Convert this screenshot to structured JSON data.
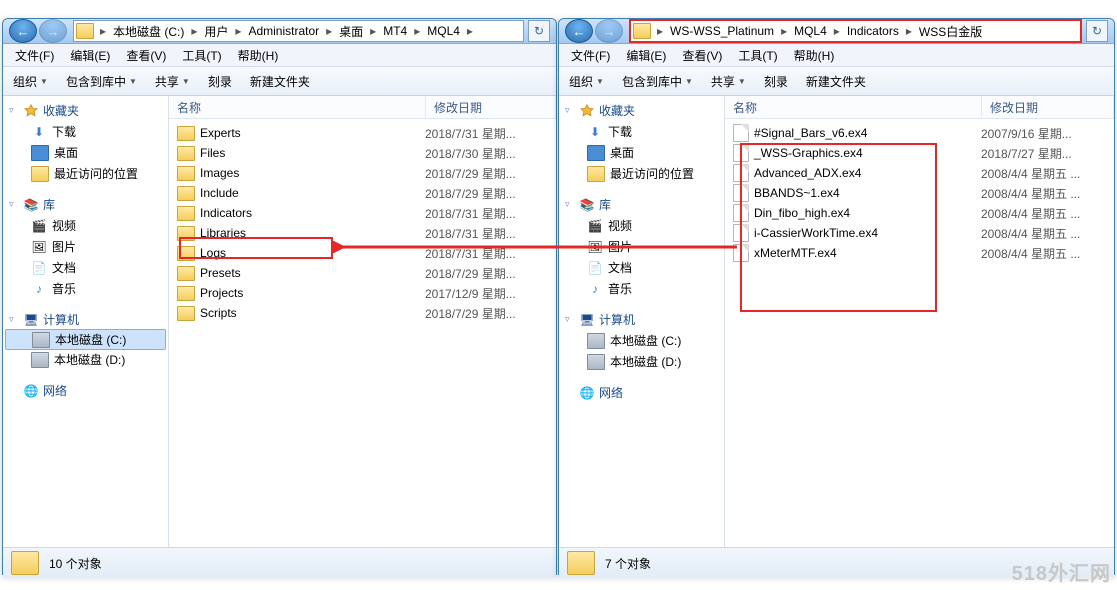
{
  "left": {
    "breadcrumbs": [
      "本地磁盘 (C:)",
      "用户",
      "Administrator",
      "桌面",
      "MT4",
      "MQL4"
    ],
    "menu": [
      "文件(F)",
      "编辑(E)",
      "查看(V)",
      "工具(T)",
      "帮助(H)"
    ],
    "toolbar": {
      "org": "组织",
      "include": "包含到库中",
      "share": "共享",
      "burn": "刻录",
      "newfolder": "新建文件夹"
    },
    "tree": {
      "favorites": {
        "label": "收藏夹",
        "children": {
          "downloads": "下载",
          "desktop": "桌面",
          "recent": "最近访问的位置"
        }
      },
      "libraries": {
        "label": "库",
        "children": {
          "videos": "视频",
          "pictures": "图片",
          "documents": "文档",
          "music": "音乐"
        }
      },
      "computer": {
        "label": "计算机",
        "children": {
          "diskc": "本地磁盘 (C:)",
          "diskd": "本地磁盘 (D:)"
        }
      },
      "network": {
        "label": "网络"
      }
    },
    "columns": {
      "name": "名称",
      "date": "修改日期"
    },
    "files": [
      {
        "name": "Experts",
        "date": "2018/7/31 星期..."
      },
      {
        "name": "Files",
        "date": "2018/7/30 星期..."
      },
      {
        "name": "Images",
        "date": "2018/7/29 星期..."
      },
      {
        "name": "Include",
        "date": "2018/7/29 星期..."
      },
      {
        "name": "Indicators",
        "date": "2018/7/31 星期...",
        "highlight": true
      },
      {
        "name": "Libraries",
        "date": "2018/7/31 星期..."
      },
      {
        "name": "Logs",
        "date": "2018/7/31 星期..."
      },
      {
        "name": "Presets",
        "date": "2018/7/29 星期..."
      },
      {
        "name": "Projects",
        "date": "2017/12/9 星期..."
      },
      {
        "name": "Scripts",
        "date": "2018/7/29 星期..."
      }
    ],
    "status": "10 个对象"
  },
  "right": {
    "breadcrumbs": [
      "WS-WSS_Platinum",
      "MQL4",
      "Indicators",
      "WSS白金版"
    ],
    "menu": [
      "文件(F)",
      "编辑(E)",
      "查看(V)",
      "工具(T)",
      "帮助(H)"
    ],
    "toolbar": {
      "org": "组织",
      "include": "包含到库中",
      "share": "共享",
      "burn": "刻录",
      "newfolder": "新建文件夹"
    },
    "tree": {
      "favorites": {
        "label": "收藏夹",
        "children": {
          "downloads": "下载",
          "desktop": "桌面",
          "recent": "最近访问的位置"
        }
      },
      "libraries": {
        "label": "库",
        "children": {
          "videos": "视频",
          "pictures": "图片",
          "documents": "文档",
          "music": "音乐"
        }
      },
      "computer": {
        "label": "计算机",
        "children": {
          "diskc": "本地磁盘 (C:)",
          "diskd": "本地磁盘 (D:)"
        }
      },
      "network": {
        "label": "网络"
      }
    },
    "columns": {
      "name": "名称",
      "date": "修改日期"
    },
    "files": [
      {
        "name": "#Signal_Bars_v6.ex4",
        "date": "2007/9/16 星期..."
      },
      {
        "name": "_WSS-Graphics.ex4",
        "date": "2018/7/27 星期..."
      },
      {
        "name": "Advanced_ADX.ex4",
        "date": "2008/4/4 星期五 ..."
      },
      {
        "name": "BBANDS~1.ex4",
        "date": "2008/4/4 星期五 ..."
      },
      {
        "name": "Din_fibo_high.ex4",
        "date": "2008/4/4 星期五 ..."
      },
      {
        "name": "i-CassierWorkTime.ex4",
        "date": "2008/4/4 星期五 ..."
      },
      {
        "name": "xMeterMTF.ex4",
        "date": "2008/4/4 星期五 ..."
      }
    ],
    "status": "7 个对象"
  },
  "watermark": "518外汇网"
}
